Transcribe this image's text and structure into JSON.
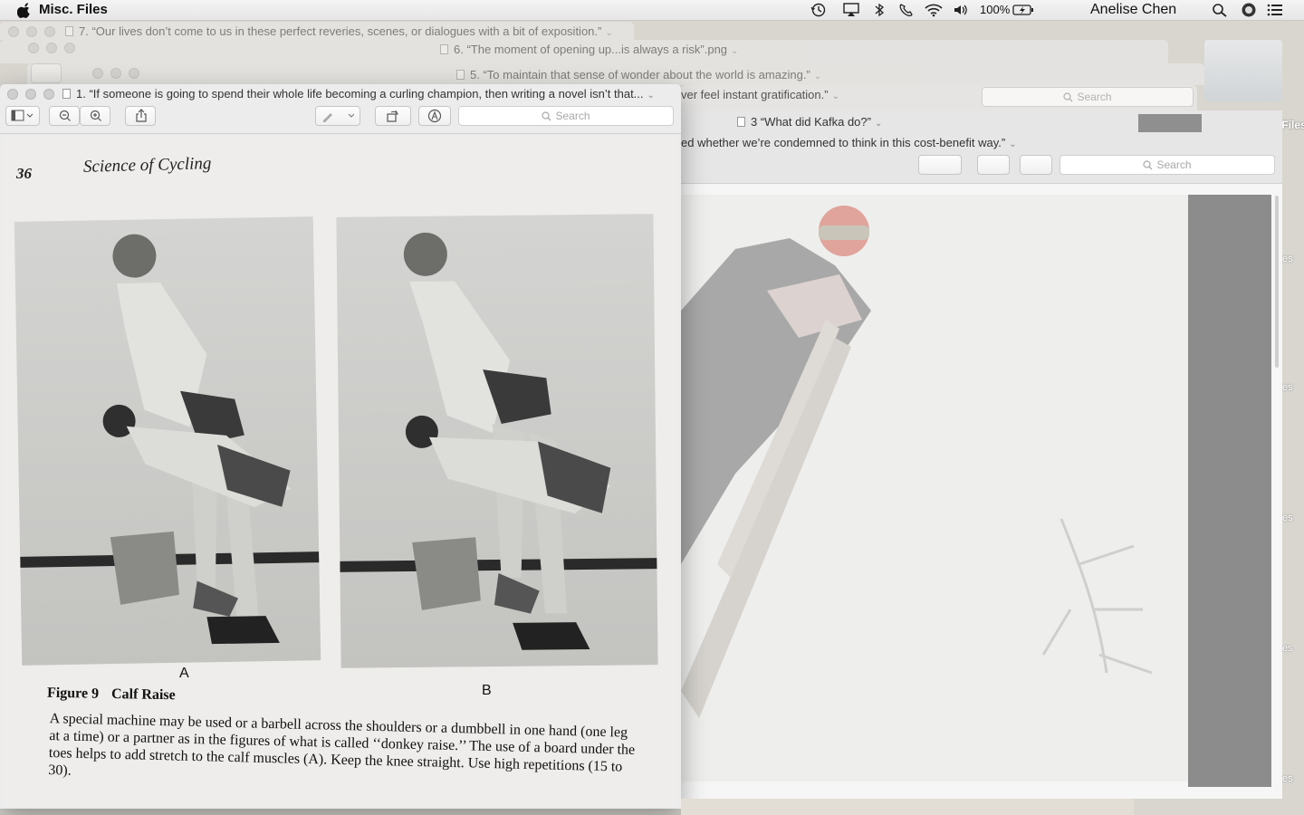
{
  "menubar": {
    "app_name": "Misc. Files",
    "battery": "100%",
    "user": "Anelise Chen"
  },
  "desktop": {
    "folder_label": "Miscellaneous Files",
    "side_fragment": "es"
  },
  "windows": {
    "w7": {
      "title": "7. “Our lives don’t come to us in these perfect reveries, scenes, or dialogues with a bit of exposition.”"
    },
    "w6": {
      "title": "6. “The moment of opening up...is always a risk”.png"
    },
    "w5": {
      "title": "5. “To maintain that sense of wonder about the world is amazing.”"
    },
    "w4": {
      "title": "ver feel instant gratification.”"
    },
    "w3": {
      "title": "3 “What did Kafka do?”"
    },
    "w2": {
      "title": "ed whether we’re condemned to think in this cost-benefit way.”"
    },
    "w1": {
      "title": "1. “If someone is going to spend their whole life becoming a curling champion, then writing a novel isn’t that..."
    }
  },
  "toolbar": {
    "search_placeholder": "Search"
  },
  "book": {
    "page_number": "36",
    "running_head": "Science of Cycling",
    "label_a": "A",
    "label_b": "B",
    "figure_number": "Figure 9",
    "figure_title": "Calf Raise",
    "body_text": "A special machine may be used or a barbell across the shoulders or a dumbbell in one hand (one leg at a time) or a partner as in the figures of what is called ‘‘donkey raise.’’ The use of a board under the toes helps to add stretch to the calf muscles (A). Keep the knee straight. Use high repetitions (15 to 30)."
  },
  "colors": {
    "menubar": "#ececec",
    "page": "#eeedeb",
    "window_chrome": "#ececec"
  }
}
